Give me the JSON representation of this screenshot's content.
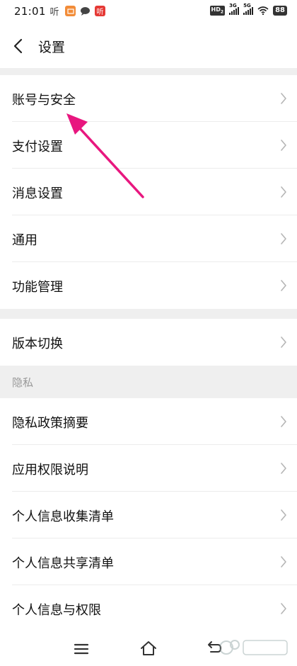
{
  "status_bar": {
    "time": "21:01",
    "app_ting": "听",
    "app_box": "",
    "app_chat": "",
    "app_ting2": "听",
    "hd": "HD",
    "hd_sub": "2",
    "sig1": "3G",
    "sig2": "5G",
    "battery": "88"
  },
  "header": {
    "title": "设置"
  },
  "menu": {
    "group1": [
      {
        "label": "账号与安全"
      },
      {
        "label": "支付设置"
      },
      {
        "label": "消息设置"
      },
      {
        "label": "通用"
      },
      {
        "label": "功能管理"
      }
    ],
    "group2": [
      {
        "label": "版本切换"
      }
    ],
    "privacy_header": "隐私",
    "group3": [
      {
        "label": "隐私政策摘要"
      },
      {
        "label": "应用权限说明"
      },
      {
        "label": "个人信息收集清单"
      },
      {
        "label": "个人信息共享清单"
      },
      {
        "label": "个人信息与权限"
      }
    ]
  },
  "colors": {
    "annotation_arrow": "#e8177f",
    "section_bg": "#efefef",
    "chevron": "#b5b5b5"
  },
  "icons": {
    "back": "chevron-left-icon",
    "row": "chevron-right-icon",
    "nav_menu": "menu-icon",
    "nav_home": "home-icon",
    "nav_back": "back-icon"
  }
}
